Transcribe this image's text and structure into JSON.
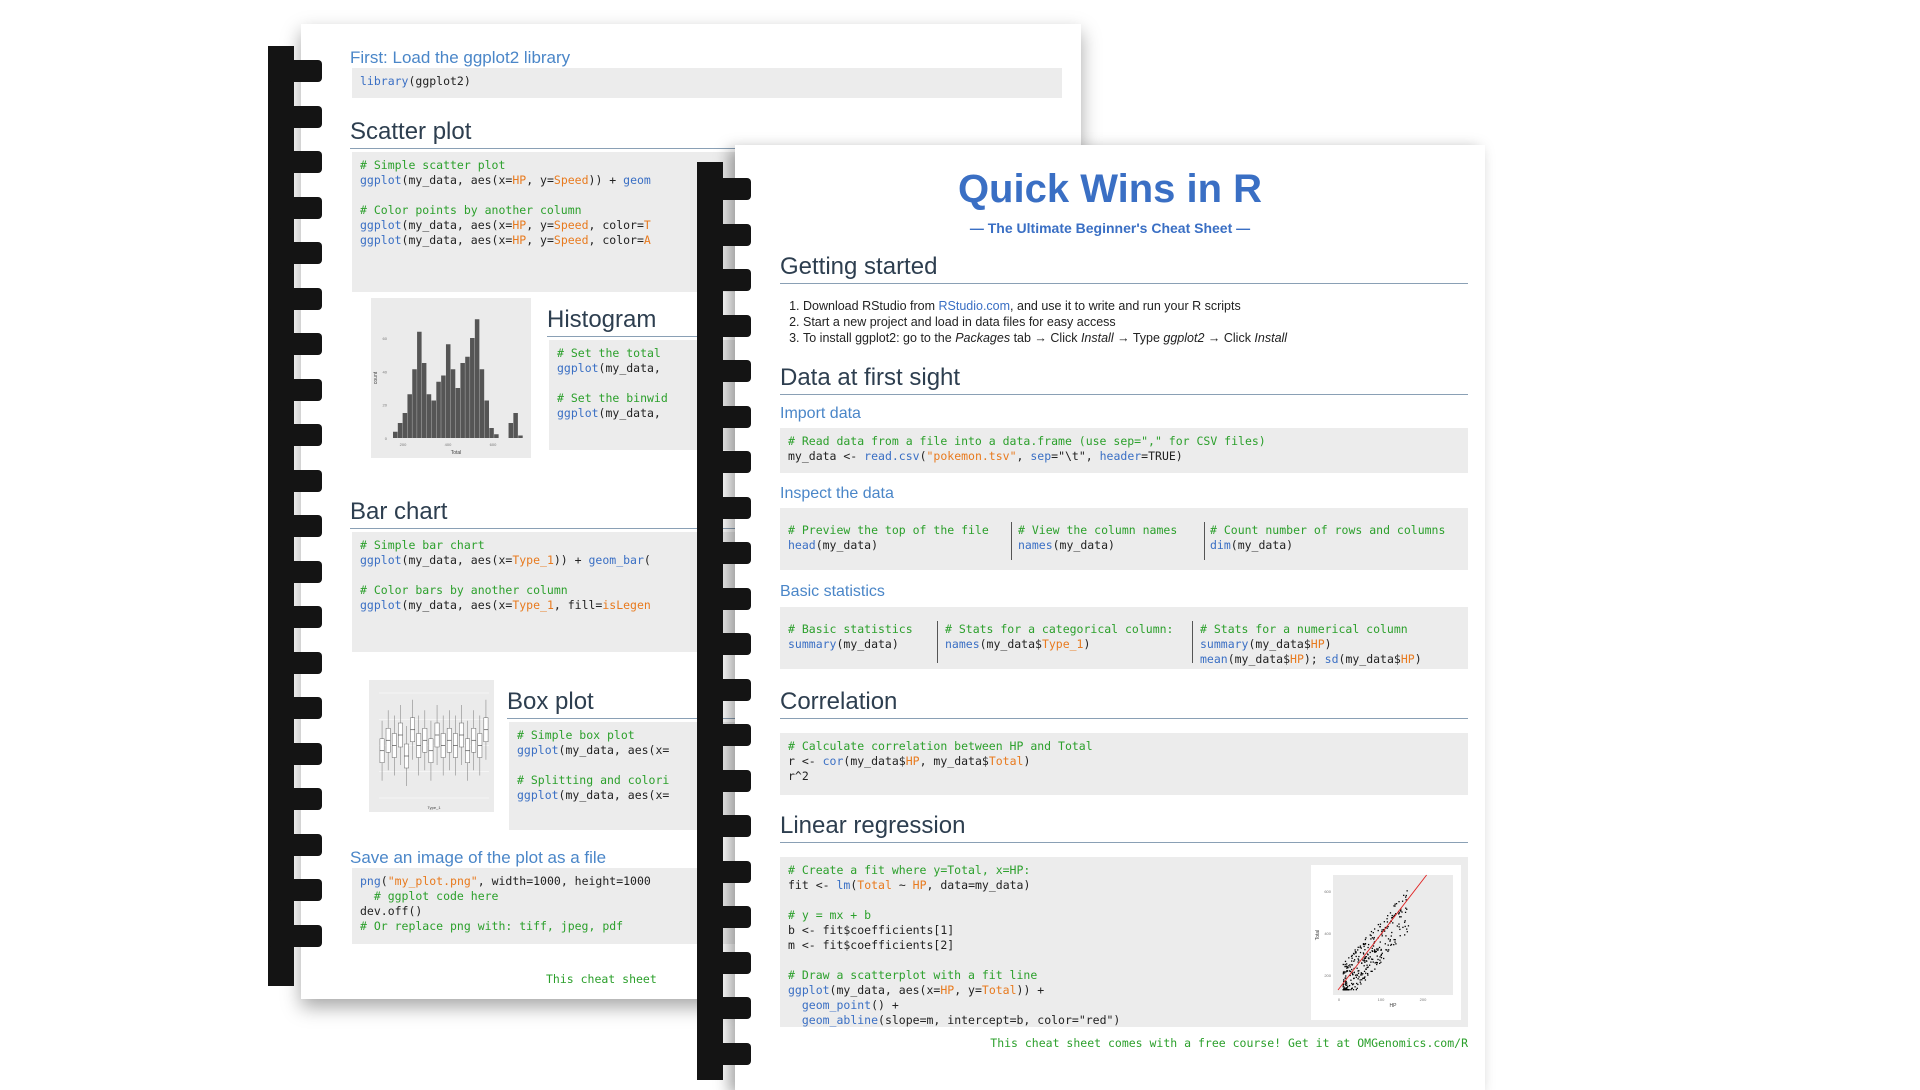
{
  "back_page": {
    "load_heading": "First: Load the ggplot2 library",
    "load_code": {
      "fn": "library",
      "rest": "(ggplot2)"
    },
    "scatter": {
      "title": "Scatter plot",
      "lines": [
        [
          [
            "c",
            "# Simple scatter plot"
          ]
        ],
        [
          [
            "f",
            "ggplot"
          ],
          [
            "p",
            "(my_data, aes(x="
          ],
          [
            "a",
            "HP"
          ],
          [
            "p",
            ", y="
          ],
          [
            "a",
            "Speed"
          ],
          [
            "p",
            ")) + "
          ],
          [
            "f",
            "geom"
          ]
        ],
        [
          [
            "p",
            ""
          ]
        ],
        [
          [
            "c",
            "# Color points by another column"
          ]
        ],
        [
          [
            "f",
            "ggplot"
          ],
          [
            "p",
            "(my_data, aes(x="
          ],
          [
            "a",
            "HP"
          ],
          [
            "p",
            ", y="
          ],
          [
            "a",
            "Speed"
          ],
          [
            "p",
            ", color="
          ],
          [
            "a",
            "T"
          ]
        ],
        [
          [
            "f",
            "ggplot"
          ],
          [
            "p",
            "(my_data, aes(x="
          ],
          [
            "a",
            "HP"
          ],
          [
            "p",
            ", y="
          ],
          [
            "a",
            "Speed"
          ],
          [
            "p",
            ", color="
          ],
          [
            "a",
            "A"
          ]
        ]
      ]
    },
    "histogram": {
      "title": "Histogram",
      "lines": [
        [
          [
            "c",
            "# Set the total"
          ]
        ],
        [
          [
            "f",
            "ggplot"
          ],
          [
            "p",
            "(my_data, "
          ]
        ],
        [
          [
            "p",
            ""
          ]
        ],
        [
          [
            "c",
            "# Set the binwid"
          ]
        ],
        [
          [
            "f",
            "ggplot"
          ],
          [
            "p",
            "(my_data, "
          ]
        ]
      ],
      "thumb_ylabel": "count",
      "thumb_xlabel": "Total",
      "thumb_yticks": [
        "60",
        "40",
        "20",
        "0"
      ],
      "thumb_xticks": [
        "200",
        "400",
        "600"
      ],
      "bars": [
        0.05,
        0.12,
        0.2,
        0.35,
        0.55,
        0.85,
        0.6,
        0.35,
        0.3,
        0.45,
        0.5,
        0.75,
        0.55,
        0.4,
        0.6,
        0.65,
        0.8,
        0.95,
        0.55,
        0.3,
        0.08,
        0.03,
        0,
        0,
        0.12,
        0.2,
        0.02
      ]
    },
    "bar_chart": {
      "title": "Bar chart",
      "lines": [
        [
          [
            "c",
            "# Simple bar chart"
          ]
        ],
        [
          [
            "f",
            "ggplot"
          ],
          [
            "p",
            "(my_data, aes(x="
          ],
          [
            "a",
            "Type_1"
          ],
          [
            "p",
            ")) + "
          ],
          [
            "f",
            "geom_bar"
          ],
          [
            "p",
            "("
          ]
        ],
        [
          [
            "p",
            ""
          ]
        ],
        [
          [
            "c",
            "# Color bars by another column"
          ]
        ],
        [
          [
            "f",
            "ggplot"
          ],
          [
            "p",
            "(my_data, aes(x="
          ],
          [
            "a",
            "Type_1"
          ],
          [
            "p",
            ", fill="
          ],
          [
            "a",
            "isLegen"
          ]
        ]
      ]
    },
    "box_plot": {
      "title": "Box plot",
      "lines": [
        [
          [
            "c",
            "# Simple box plot"
          ]
        ],
        [
          [
            "f",
            "ggplot"
          ],
          [
            "p",
            "(my_data, aes(x="
          ]
        ],
        [
          [
            "p",
            ""
          ]
        ],
        [
          [
            "c",
            "# Splitting and colori"
          ]
        ],
        [
          [
            "f",
            "ggplot"
          ],
          [
            "p",
            "(my_data, aes(x="
          ]
        ]
      ],
      "thumb_xlabel": "Type_1",
      "boxes": [
        0.45,
        0.55,
        0.5,
        0.6,
        0.4,
        0.65,
        0.5,
        0.55,
        0.45,
        0.6,
        0.5,
        0.55,
        0.5,
        0.6,
        0.45,
        0.55,
        0.5,
        0.65
      ]
    },
    "save": {
      "title": "Save an image of the plot as a file",
      "lines": [
        [
          [
            "f",
            "png"
          ],
          [
            "p",
            "("
          ],
          [
            "a",
            "\"my_plot.png\""
          ],
          [
            "p",
            ", width=1000, height=1000"
          ]
        ],
        [
          [
            "c",
            "  # ggplot code here"
          ]
        ],
        [
          [
            "p",
            "dev.off()"
          ]
        ],
        [
          [
            "c",
            "# Or replace png with: tiff, jpeg, pdf"
          ]
        ]
      ]
    },
    "footer": "This cheat sheet"
  },
  "front_page": {
    "title": "Quick Wins in R",
    "subtitle": "— The Ultimate Beginner's Cheat Sheet —",
    "getting_started": {
      "title": "Getting started",
      "item1_a": "Download RStudio from ",
      "item1_link": "RStudio.com",
      "item1_b": ", and use it to write and run your R scripts",
      "item2": "Start a new project and load in data files for easy access",
      "item3_a": "To install ggplot2: go to the ",
      "item3_pkg": "Packages",
      "item3_b": " tab → Click ",
      "item3_install": "Install",
      "item3_c": " → Type ",
      "item3_gg": "ggplot2",
      "item3_d": " → Click ",
      "item3_install2": "Install"
    },
    "data_first_sight": {
      "title": "Data at first sight",
      "import_heading": "Import data",
      "import_lines": [
        [
          [
            "c",
            "# Read data from a file into a data.frame (use sep=\",\" for CSV files)"
          ]
        ],
        [
          [
            "p",
            "my_data <- "
          ],
          [
            "f",
            "read.csv"
          ],
          [
            "p",
            "("
          ],
          [
            "a",
            "\"pokemon.tsv\""
          ],
          [
            "p",
            ", "
          ],
          [
            "f",
            "sep"
          ],
          [
            "p",
            "=\"\\t\", "
          ],
          [
            "f",
            "header"
          ],
          [
            "p",
            "=TRUE)"
          ]
        ]
      ],
      "inspect_heading": "Inspect the data",
      "inspect_cols": [
        [
          [
            [
              "c",
              "# Preview the top of the file"
            ]
          ],
          [
            [
              "f",
              "head"
            ],
            [
              "p",
              "(my_data)"
            ]
          ]
        ],
        [
          [
            [
              "c",
              "# View the column names"
            ]
          ],
          [
            [
              "f",
              "names"
            ],
            [
              "p",
              "(my_data)"
            ]
          ]
        ],
        [
          [
            [
              "c",
              "# Count number of rows and columns"
            ]
          ],
          [
            [
              "f",
              "dim"
            ],
            [
              "p",
              "(my_data)"
            ]
          ]
        ]
      ],
      "stats_heading": "Basic statistics",
      "stats_cols": [
        [
          [
            [
              "c",
              "# Basic statistics"
            ]
          ],
          [
            [
              "f",
              "summary"
            ],
            [
              "p",
              "(my_data)"
            ]
          ]
        ],
        [
          [
            [
              "c",
              "# Stats for a categorical column:"
            ]
          ],
          [
            [
              "f",
              "names"
            ],
            [
              "p",
              "(my_data$"
            ],
            [
              "a",
              "Type_1"
            ],
            [
              "p",
              ")"
            ]
          ]
        ],
        [
          [
            [
              "c",
              "# Stats for a numerical column"
            ]
          ],
          [
            [
              "f",
              "summary"
            ],
            [
              "p",
              "(my_data$"
            ],
            [
              "a",
              "HP"
            ],
            [
              "p",
              ")"
            ]
          ],
          [
            [
              "f",
              "mean"
            ],
            [
              "p",
              "(my_data$"
            ],
            [
              "a",
              "HP"
            ],
            [
              "p",
              "); "
            ],
            [
              "f",
              "sd"
            ],
            [
              "p",
              "(my_data$"
            ],
            [
              "a",
              "HP"
            ],
            [
              "p",
              ")"
            ]
          ]
        ]
      ]
    },
    "correlation": {
      "title": "Correlation",
      "lines": [
        [
          [
            "c",
            "# Calculate correlation between HP and Total"
          ]
        ],
        [
          [
            "p",
            "r <- "
          ],
          [
            "f",
            "cor"
          ],
          [
            "p",
            "(my_data$"
          ],
          [
            "a",
            "HP"
          ],
          [
            "p",
            ", my_data$"
          ],
          [
            "a",
            "Total"
          ],
          [
            "p",
            ")"
          ]
        ],
        [
          [
            "p",
            "r^2"
          ]
        ]
      ]
    },
    "regression": {
      "title": "Linear regression",
      "lines": [
        [
          [
            "c",
            "# Create a fit where y=Total, x=HP:"
          ]
        ],
        [
          [
            "p",
            "fit <- "
          ],
          [
            "f",
            "lm"
          ],
          [
            "p",
            "("
          ],
          [
            "a",
            "Total"
          ],
          [
            "p",
            " ~ "
          ],
          [
            "a",
            "HP"
          ],
          [
            "p",
            ", data=my_data)"
          ]
        ],
        [
          [
            "p",
            ""
          ]
        ],
        [
          [
            "c",
            "# y = mx + b"
          ]
        ],
        [
          [
            "p",
            "b <- fit$coefficients[1]"
          ]
        ],
        [
          [
            "p",
            "m <- fit$coefficients[2]"
          ]
        ],
        [
          [
            "p",
            ""
          ]
        ],
        [
          [
            "c",
            "# Draw a scatterplot with a fit line"
          ]
        ],
        [
          [
            "f",
            "ggplot"
          ],
          [
            "p",
            "(my_data, aes(x="
          ],
          [
            "a",
            "HP"
          ],
          [
            "p",
            ", y="
          ],
          [
            "a",
            "Total"
          ],
          [
            "p",
            ")) +"
          ]
        ],
        [
          [
            "p",
            "  "
          ],
          [
            "f",
            "geom_point"
          ],
          [
            "p",
            "() +"
          ]
        ],
        [
          [
            "p",
            "  "
          ],
          [
            "f",
            "geom_abline"
          ],
          [
            "p",
            "(slope=m, intercept=b, color=\"red\")"
          ]
        ]
      ],
      "thumb_ylabel": "Total",
      "thumb_xlabel": "HP",
      "thumb_yticks": [
        "600",
        "400",
        "200"
      ],
      "thumb_xticks": [
        "0",
        "100",
        "200"
      ]
    },
    "footer": "This cheat sheet comes with a free course! Get it at OMGenomics.com/R"
  },
  "colors": {
    "comment": "#2ca02c",
    "function": "#3a6fc4",
    "argument": "#e87a1e",
    "heading": "#4a86c8",
    "title": "#3a6fc4"
  }
}
